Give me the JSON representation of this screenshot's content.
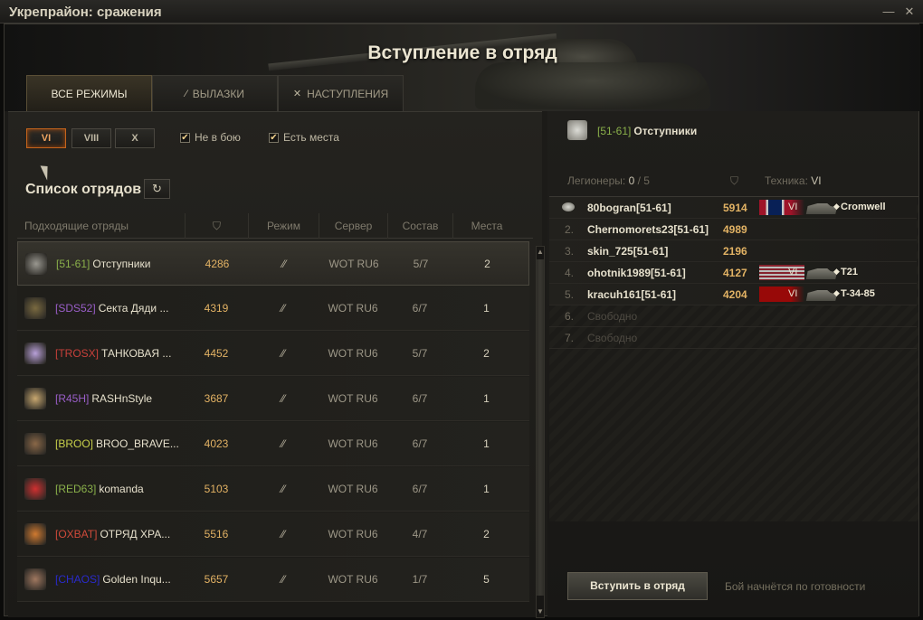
{
  "window": {
    "title": "Укрепрайон: сражения",
    "minimize_glyph": "—",
    "close_glyph": "✕"
  },
  "banner": {
    "title": "Вступление в отряд"
  },
  "tabs": [
    {
      "label": "ВСЕ РЕЖИМЫ",
      "icon": "",
      "active": true
    },
    {
      "label": "ВЫЛАЗКИ",
      "icon": "sortie-icon",
      "active": false
    },
    {
      "label": "НАСТУПЛЕНИЯ",
      "icon": "attack-icon",
      "active": false
    }
  ],
  "filters": {
    "tiers": [
      "VI",
      "VIII",
      "X"
    ],
    "active_tier": "VI",
    "not_in_battle": {
      "label": "Не в бою",
      "checked": true
    },
    "has_places": {
      "label": "Есть места",
      "checked": true
    }
  },
  "list": {
    "title": "Список отрядов",
    "columns": {
      "teams": "Подходящие отряды",
      "rating_icon": "rating-icon",
      "mode": "Режим",
      "server": "Сервер",
      "composition": "Состав",
      "places": "Места"
    },
    "rows": [
      {
        "tag": "[51-61]",
        "tag_color": "#8ab04a",
        "name": "Отступники",
        "rating": "4286",
        "server": "WOT RU6",
        "comp": "5/7",
        "places": "2",
        "emblem": "wolf-emblem-icon",
        "emblem_color": "#9a9890",
        "selected": true
      },
      {
        "tag": "[SDS52]",
        "tag_color": "#9a5ec8",
        "name": "Секта Дяди ...",
        "rating": "4319",
        "server": "WOT RU6",
        "comp": "6/7",
        "places": "1",
        "emblem": "tank-emblem-icon",
        "emblem_color": "#7a6a40",
        "selected": false
      },
      {
        "tag": "[TROSX]",
        "tag_color": "#c8403a",
        "name": "ТАНКОВАЯ ...",
        "rating": "4452",
        "server": "WOT RU6",
        "comp": "5/7",
        "places": "2",
        "emblem": "shield-emblem-icon",
        "emblem_color": "#b8a0d8",
        "selected": false
      },
      {
        "tag": "[R45H]",
        "tag_color": "#9a5ec8",
        "name": "RASHnStyle",
        "rating": "3687",
        "server": "WOT RU6",
        "comp": "6/7",
        "places": "1",
        "emblem": "beast-emblem-icon",
        "emblem_color": "#c8a870",
        "selected": false
      },
      {
        "tag": "[BROO]",
        "tag_color": "#c8d04a",
        "name": "BROO_BRAVE...",
        "rating": "4023",
        "server": "WOT RU6",
        "comp": "6/7",
        "places": "1",
        "emblem": "portrait-emblem-icon",
        "emblem_color": "#8a6848",
        "selected": false
      },
      {
        "tag": "[RED63]",
        "tag_color": "#8ab04a",
        "name": "komanda",
        "rating": "5103",
        "server": "WOT RU6",
        "comp": "6/7",
        "places": "1",
        "emblem": "ball-emblem-icon",
        "emblem_color": "#d03030",
        "selected": false
      },
      {
        "tag": "[OXBAT]",
        "tag_color": "#d04a3a",
        "name": "ОТРЯД ХРА...",
        "rating": "5516",
        "server": "WOT RU6",
        "comp": "4/7",
        "places": "2",
        "emblem": "star-emblem-icon",
        "emblem_color": "#d07a30",
        "selected": false
      },
      {
        "tag": "[CHAOS]",
        "tag_color": "#2a2acc",
        "name": "Golden Inqu...",
        "rating": "5657",
        "server": "WOT RU6",
        "comp": "1/7",
        "places": "5",
        "emblem": "knight-emblem-icon",
        "emblem_color": "#a07860",
        "selected": false
      }
    ]
  },
  "team": {
    "tag": "[51-61]",
    "name": "Отступники",
    "legionnaires_label": "Легионеры:",
    "legionnaires_value": "0",
    "legionnaires_max": "/ 5",
    "tech_label": "Техника:",
    "tech_value": "VI",
    "slots": [
      {
        "num": "",
        "name": "80bogran[51-61]",
        "rating": "5914",
        "flag": "uk",
        "tier": "VI",
        "tank": "Cromwell",
        "commander": true
      },
      {
        "num": "2.",
        "name": "Chernomorets23[51-61]",
        "rating": "4989",
        "flag": "",
        "tier": "",
        "tank": ""
      },
      {
        "num": "3.",
        "name": "skin_725[51-61]",
        "rating": "2196",
        "flag": "",
        "tier": "",
        "tank": ""
      },
      {
        "num": "4.",
        "name": "ohotnik1989[51-61]",
        "rating": "4127",
        "flag": "usa",
        "tier": "VI",
        "tank": "T21"
      },
      {
        "num": "5.",
        "name": "kracuh161[51-61]",
        "rating": "4204",
        "flag": "ussr",
        "tier": "VI",
        "tank": "T-34-85"
      },
      {
        "num": "6.",
        "name": "Свободно",
        "rating": "",
        "flag": "",
        "tier": "",
        "tank": "",
        "free": true
      },
      {
        "num": "7.",
        "name": "Свободно",
        "rating": "",
        "flag": "",
        "tier": "",
        "tank": "",
        "free": true
      }
    ],
    "join_label": "Вступить в отряд",
    "ready_text": "Бой начнётся по готовности"
  },
  "colors": {
    "rating": "#e2b264",
    "accent_orange": "#c4641c",
    "text_primary": "#e6e0cc"
  }
}
